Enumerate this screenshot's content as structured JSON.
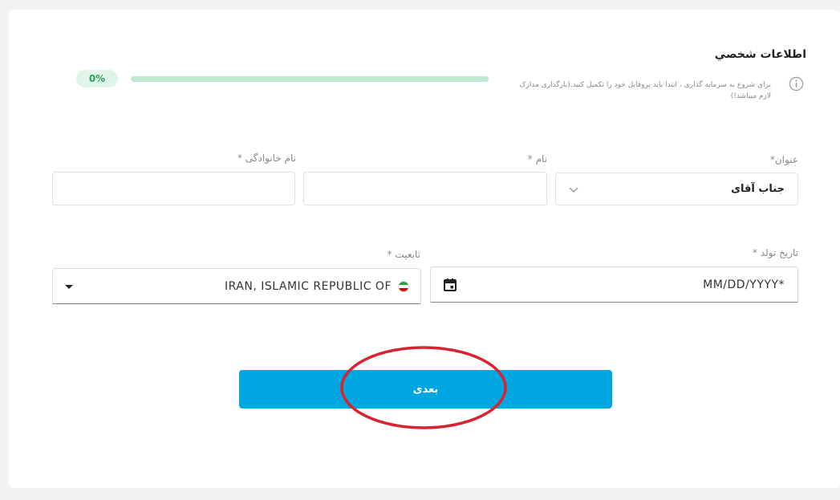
{
  "section": {
    "title": "اطلاعات شخصي",
    "notice": "برای شروع به سرمایه گذاری ، ابتدا باید پروفایل خود را تکمیل کنید.(بارگذاری مدارک لازم میباشد!)"
  },
  "progress": {
    "label": "0%",
    "value": 0
  },
  "fields": {
    "title": {
      "label": "عنوان*",
      "value": "جناب آقای"
    },
    "first_name": {
      "label": "نام *",
      "value": ""
    },
    "last_name": {
      "label": "نام خانوادگی *",
      "value": ""
    },
    "birth_date": {
      "label": "تاریخ تولد *",
      "placeholder": "MM/DD/YYYY*"
    },
    "nationality": {
      "label": "تابعیت *",
      "value": "IRAN, ISLAMIC REPUBLIC OF"
    }
  },
  "actions": {
    "next_label": "بعدی"
  },
  "colors": {
    "accent": "#00a7e0",
    "progress_text": "#2e9f5f",
    "highlight": "#d9232e"
  },
  "icons": {
    "info": "info-icon",
    "chevron": "chevron-down-icon",
    "calendar": "calendar-icon",
    "dropdown": "caret-down-icon",
    "flag": "iran-flag-icon"
  }
}
